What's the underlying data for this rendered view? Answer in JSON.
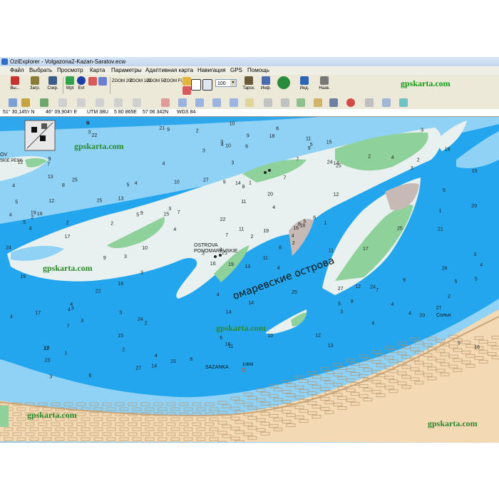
{
  "window": {
    "title": "OziExplorer - Volgazona2-Kazan-Saratov.ecw"
  },
  "menu": [
    "Файл",
    "Выбрать",
    "Просмотр",
    "Карта",
    "Параметры",
    "Адаптивная карта",
    "Навигация",
    "GPS",
    "Помощь"
  ],
  "toolbar": {
    "exit": "Вы...",
    "load": "Загр.",
    "save": "Сокр.",
    "wpt": "Wpt",
    "evt": "Evt",
    "zoom_in": "ZOOM 200",
    "zoom_100": "ZOOM 100",
    "zoom_50": "ZOOM 50",
    "zoom_full": "ZOOM FULL",
    "zoom_level": "100",
    "tarsk": "Тарск.",
    "info": "Инф.",
    "ind": "Инд.",
    "nazv": "Назв.",
    "watermark": "gpskarta.com"
  },
  "coords": {
    "lat": "51° 30,145'r N",
    "lon": "46° 09,904'r E",
    "utm": "UTM 38U",
    "easting": "5 80 865E",
    "northing": "57 06 342N",
    "datum": "WGS 84"
  },
  "map": {
    "island_label": "омаревские острова",
    "ostrova_label_1": "OSTROVA",
    "ostrova_label_2": "PONOMAREVSKIE",
    "sazanka_label": "SAZANKA",
    "km_label": "10КМ",
    "solny_label": "Сольн",
    "left_label": "OV",
    "left_label_2": "SKIE PESK",
    "watermarks": [
      "gpskarta.com",
      "gpskarta.com",
      "gpskarta.com",
      "gpskarta.com",
      "gpskarta.com"
    ],
    "soundings": [
      "13",
      "8",
      "21",
      "18",
      "16",
      "2",
      "15",
      "1",
      "14",
      "6",
      "22",
      "17",
      "15",
      "16",
      "12",
      "6",
      "9",
      "4",
      "3",
      "7",
      "23",
      "2",
      "14",
      "18",
      "7",
      "25",
      "10",
      "4",
      "27",
      "20",
      "3",
      "6",
      "7",
      "4",
      "2",
      "24",
      "9",
      "24",
      "6",
      "15",
      "2",
      "3",
      "27",
      "4",
      "4",
      "3",
      "11",
      "2",
      "7",
      "5",
      "12",
      "9",
      "13",
      "15",
      "3",
      "10",
      "2",
      "9",
      "10",
      "16",
      "13",
      "4",
      "6",
      "5",
      "3",
      "11",
      "4",
      "14",
      "15",
      "12",
      "5",
      "17",
      "25",
      "19",
      "22",
      "19",
      "1",
      "11",
      "2",
      "21",
      "14",
      "12",
      "3",
      "4",
      "1",
      "4",
      "2",
      "27",
      "2",
      "24",
      "25",
      "9",
      "21",
      "3",
      "5",
      "22",
      "3",
      "4",
      "8",
      "3",
      "4",
      "26",
      "7",
      "8",
      "3",
      "9",
      "17",
      "19",
      "16",
      "27",
      "2",
      "4",
      "3",
      "20",
      "10",
      "17",
      "16",
      "25",
      "13",
      "3",
      "9",
      "4",
      "5",
      "4",
      "3",
      "4",
      "5",
      "3",
      "4",
      "2",
      "4",
      "11",
      "5",
      "9",
      "8",
      "16",
      "4",
      "1",
      "5",
      "19",
      "9",
      "18",
      "3",
      "11",
      "3",
      "7",
      "25",
      "6",
      "24",
      "10",
      "9",
      "12",
      "4",
      "16",
      "4",
      "20",
      "5",
      "11",
      "6",
      "14",
      "7",
      "5",
      "4"
    ]
  }
}
